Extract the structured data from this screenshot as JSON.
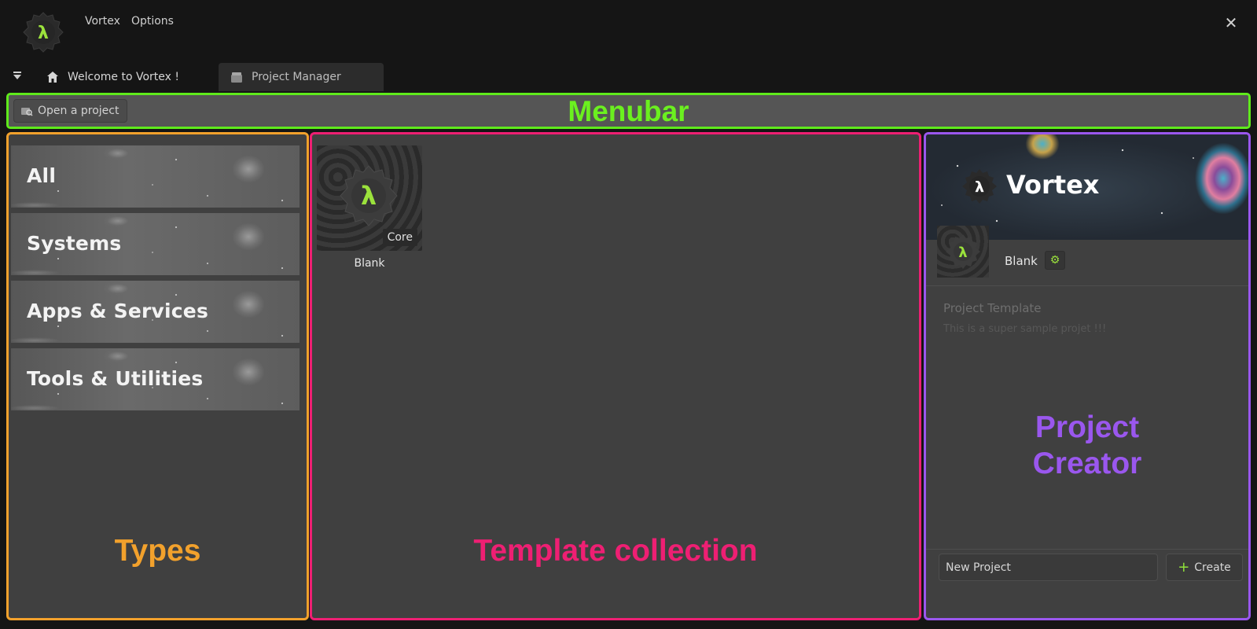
{
  "app": {
    "menu": [
      "Vortex",
      "Options"
    ],
    "close_glyph": "✕"
  },
  "tabs": [
    {
      "label": "Welcome to Vortex !",
      "icon": "home-icon",
      "active": false
    },
    {
      "label": "Project Manager",
      "icon": "folder-icon",
      "active": true
    }
  ],
  "menubar": {
    "open_project_label": "Open a project",
    "annotation": "Menubar"
  },
  "types": {
    "items": [
      "All",
      "Systems",
      "Apps & Services",
      "Tools & Utilities"
    ],
    "annotation": "Types"
  },
  "templates": {
    "items": [
      {
        "name": "Blank",
        "badge": "Core"
      }
    ],
    "annotation": "Template collection"
  },
  "creator": {
    "banner_title": "Vortex",
    "project_name": "Blank",
    "template_type": "Project Template",
    "description": "This is a super sample projet !!!",
    "input_value": "New Project",
    "create_label": "Create",
    "annotation_line1": "Project",
    "annotation_line2": "Creator"
  },
  "colors": {
    "menubar_outline": "#5fea1b",
    "types_outline": "#f2a12c",
    "templates_outline": "#ee1f73",
    "creator_outline": "#9a57ee",
    "accent": "#9be23c"
  }
}
